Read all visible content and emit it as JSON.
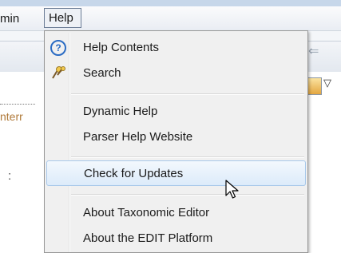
{
  "menubar": {
    "admin_label": "min",
    "help_label": "Help"
  },
  "help_menu": {
    "items": [
      {
        "label": "Help Contents",
        "icon": "help-contents-icon"
      },
      {
        "label": "Search",
        "icon": "search-help-icon"
      },
      {
        "label": "Dynamic Help"
      },
      {
        "label": "Parser Help Website"
      },
      {
        "label": "Check for Updates",
        "highlighted": true
      },
      {
        "label": "About Taxonomic Editor"
      },
      {
        "label": "About the EDIT Platform"
      }
    ]
  },
  "background": {
    "left_label": "nterr",
    "colon": ":"
  },
  "colors": {
    "menu_bg": "#f0f0f0",
    "highlight_border": "#a8c8ea",
    "help_icon": "#2b6cc4"
  }
}
